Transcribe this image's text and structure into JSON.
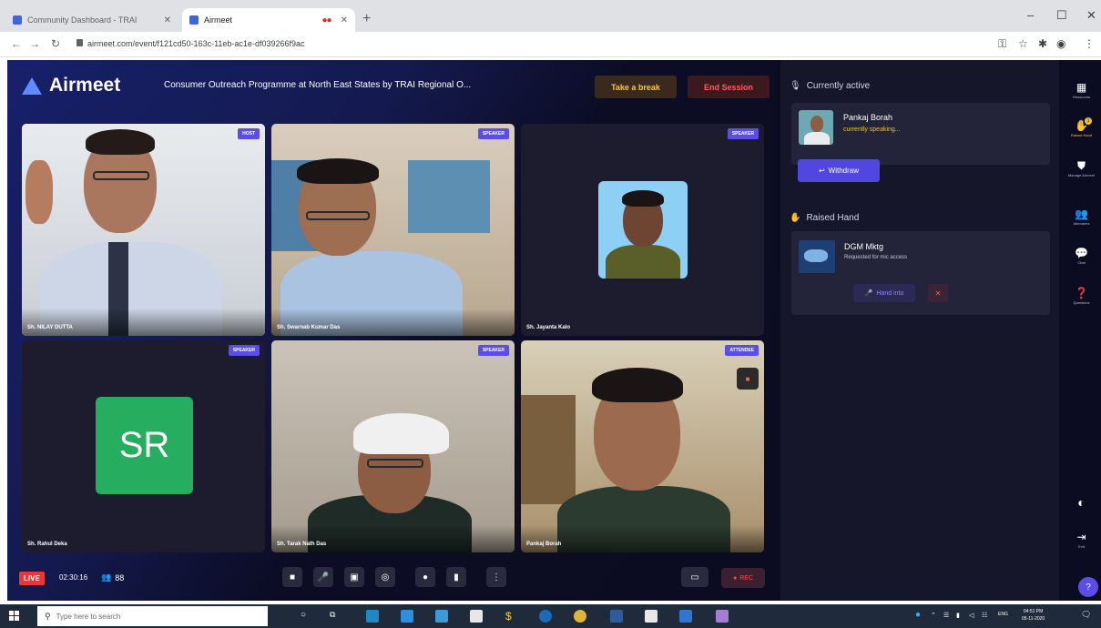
{
  "browser": {
    "tabs": [
      {
        "title": "Community Dashboard - TRAI"
      },
      {
        "title": "Airmeet"
      }
    ],
    "url": "airmeet.com/event/f121cd50-163c-11eb-ac1e-df039266f9ac",
    "new_tab_label": "+"
  },
  "app": {
    "brand_name": "Airmeet",
    "session_title": "Consumer Outreach Programme at North East States by TRAI Regional O...",
    "take_break_label": "Take a break",
    "end_session_label": "End Session",
    "tiles": [
      {
        "name": "Sh. NILAY DUTTA",
        "role": "HOST"
      },
      {
        "name": "Sh. Swarnab Kumar Das",
        "role": "SPEAKER"
      },
      {
        "name": "Sh. Jayanta Kalo",
        "role": "SPEAKER"
      },
      {
        "name": "Sh. Rahul Deka",
        "role": "SPEAKER",
        "initials": "SR"
      },
      {
        "name": "Sh. Tarak Nath Das",
        "role": "SPEAKER"
      },
      {
        "name": "Pankaj Borah",
        "role": "ATTENDEE"
      }
    ],
    "live_label": "LIVE",
    "live_timer": "02:30:16",
    "attendee_count": "88",
    "rec_label": "REC"
  },
  "panel": {
    "currently_active_title": "Currently active",
    "active_speaker": {
      "name": "Pankaj Borah",
      "status": "currently speaking..."
    },
    "withdraw_label": "Withdraw",
    "raised_hand_title": "Raised Hand",
    "raised_entry": {
      "name": "DGM Mktg",
      "desc": "Requested for mic access",
      "action": "Hand into"
    }
  },
  "rail": [
    {
      "label": "Resources",
      "icon": "resources-icon"
    },
    {
      "label": "Raised Hand",
      "icon": "hand-icon",
      "badge": "1"
    },
    {
      "label": "Manage Airmeet",
      "icon": "manage-icon"
    },
    {
      "label": "Attendees",
      "icon": "attendees-icon"
    },
    {
      "label": "Chat",
      "icon": "chat-icon"
    },
    {
      "label": "Questions",
      "icon": "questions-icon"
    },
    {
      "label": "Exit",
      "icon": "exit-icon"
    }
  ],
  "taskbar": {
    "search_placeholder": "Type here to search",
    "lang": "ENG",
    "time": "04:51 PM",
    "date": "05-11-2020"
  },
  "colors": {
    "accent": "#5b4ee8",
    "live": "#e53935",
    "warning": "#f1c232",
    "sr_avatar": "#27ad5f"
  }
}
